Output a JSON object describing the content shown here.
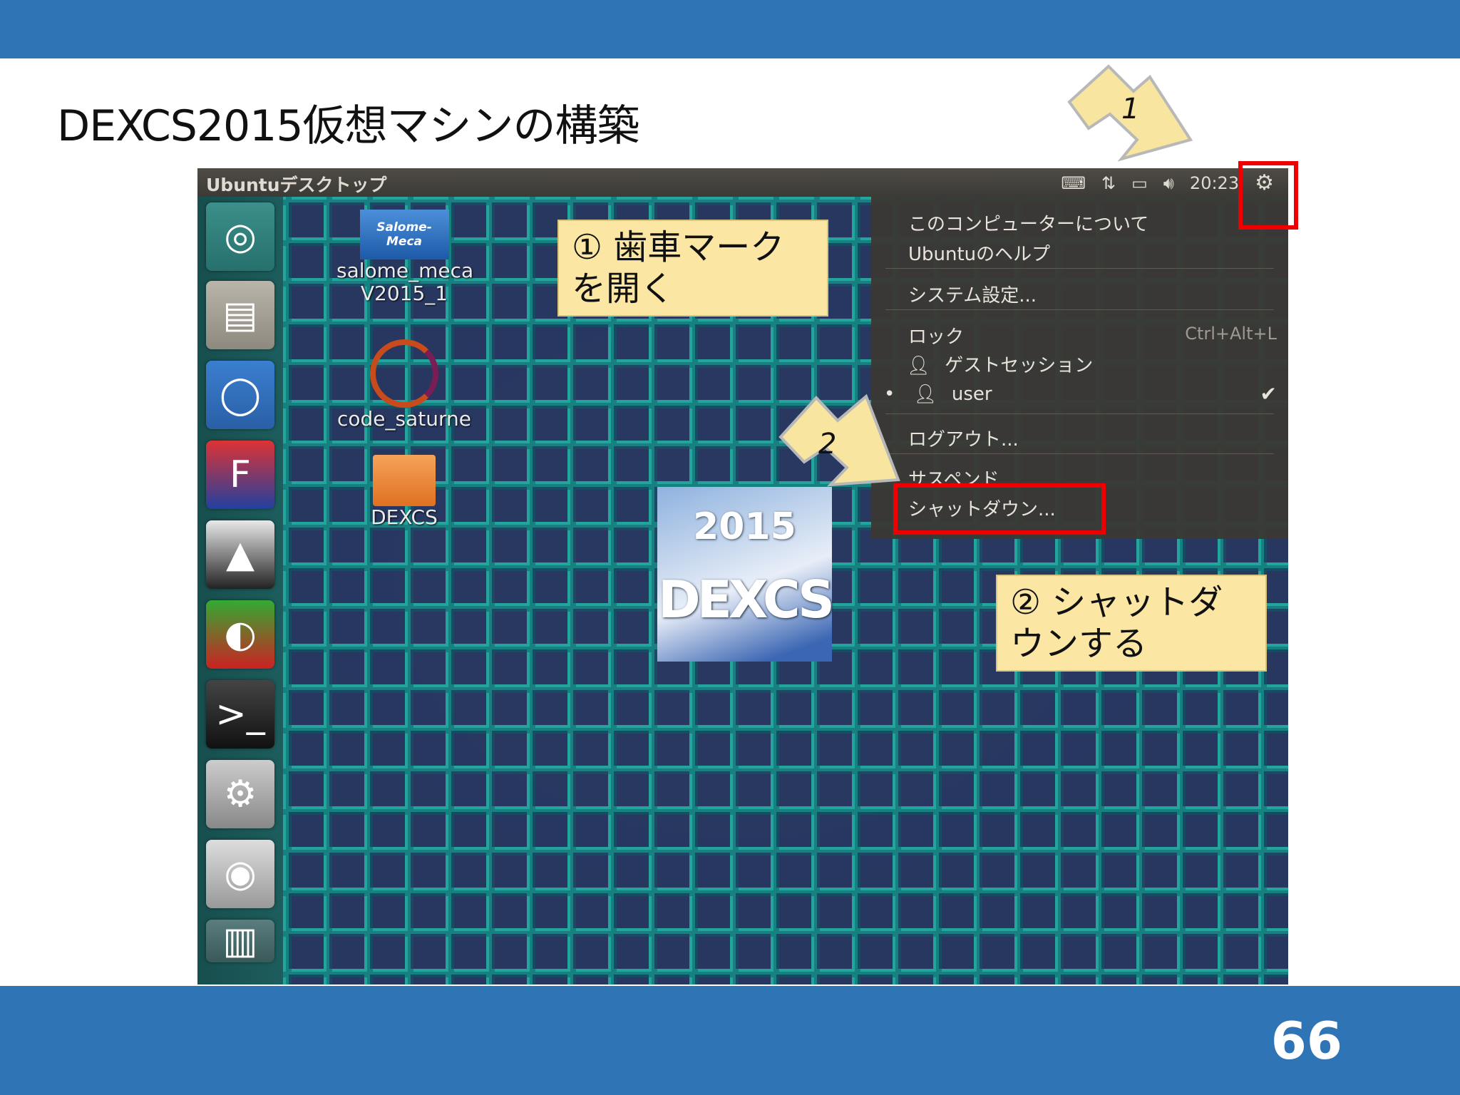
{
  "slide": {
    "title": "DEXCS2015仮想マシンの構築",
    "page_number": "66"
  },
  "ubuntu": {
    "title": "Ubuntuデスクトップ",
    "clock": "20:23",
    "tray_icons": [
      "keyboard-icon",
      "network-icon",
      "battery-icon",
      "volume-icon",
      "gear-icon"
    ]
  },
  "launcher": {
    "items": [
      "ubuntu-dash-icon",
      "files-icon",
      "chromium-icon",
      "freecad-icon",
      "paraview-icon",
      "salome-icon",
      "terminal-icon",
      "system-tools-icon",
      "dvd-icon",
      "trash-icon"
    ]
  },
  "desktop": {
    "icons": [
      {
        "logo": "Salome-Meca",
        "label_line1": "salome_meca",
        "label_line2": "V2015_1"
      },
      {
        "label_line1": "code_saturne"
      },
      {
        "label_line1": "DEXCS"
      }
    ],
    "center_logo": {
      "year": "2015",
      "word": "DEXCS"
    }
  },
  "menu": {
    "items": [
      {
        "label": "このコンピューターについて"
      },
      {
        "label": "Ubuntuのヘルプ"
      },
      {
        "label": "システム設定..."
      },
      {
        "label": "ロック",
        "shortcut": "Ctrl+Alt+L"
      },
      {
        "label": "ゲストセッション"
      },
      {
        "label": "user"
      },
      {
        "label": "ログアウト..."
      },
      {
        "label": "サスペンド"
      },
      {
        "label": "シャットダウン..."
      }
    ]
  },
  "notes": {
    "step1": {
      "line1": "① 歯車マーク",
      "line2": "を開く"
    },
    "step2": {
      "line1": "② シャットダ",
      "line2": "ウンする"
    }
  },
  "arrows": {
    "arrow1_label": "1",
    "arrow2_label": "2"
  },
  "colors": {
    "banner": "#2f74b5",
    "highlight_border": "#ee0000",
    "note_fill": "#fbe6a3",
    "arrow_fill": "#f8e6a0"
  }
}
